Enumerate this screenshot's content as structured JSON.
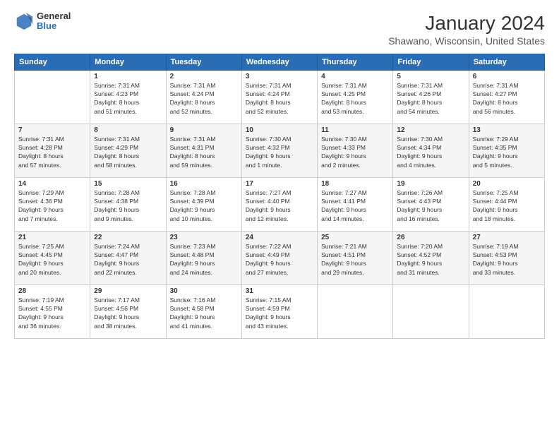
{
  "header": {
    "logo_general": "General",
    "logo_blue": "Blue",
    "title": "January 2024",
    "subtitle": "Shawano, Wisconsin, United States"
  },
  "days_of_week": [
    "Sunday",
    "Monday",
    "Tuesday",
    "Wednesday",
    "Thursday",
    "Friday",
    "Saturday"
  ],
  "weeks": [
    [
      {
        "day": "",
        "info": ""
      },
      {
        "day": "1",
        "info": "Sunrise: 7:31 AM\nSunset: 4:23 PM\nDaylight: 8 hours\nand 51 minutes."
      },
      {
        "day": "2",
        "info": "Sunrise: 7:31 AM\nSunset: 4:24 PM\nDaylight: 8 hours\nand 52 minutes."
      },
      {
        "day": "3",
        "info": "Sunrise: 7:31 AM\nSunset: 4:24 PM\nDaylight: 8 hours\nand 52 minutes."
      },
      {
        "day": "4",
        "info": "Sunrise: 7:31 AM\nSunset: 4:25 PM\nDaylight: 8 hours\nand 53 minutes."
      },
      {
        "day": "5",
        "info": "Sunrise: 7:31 AM\nSunset: 4:26 PM\nDaylight: 8 hours\nand 54 minutes."
      },
      {
        "day": "6",
        "info": "Sunrise: 7:31 AM\nSunset: 4:27 PM\nDaylight: 8 hours\nand 56 minutes."
      }
    ],
    [
      {
        "day": "7",
        "info": "Sunrise: 7:31 AM\nSunset: 4:28 PM\nDaylight: 8 hours\nand 57 minutes."
      },
      {
        "day": "8",
        "info": "Sunrise: 7:31 AM\nSunset: 4:29 PM\nDaylight: 8 hours\nand 58 minutes."
      },
      {
        "day": "9",
        "info": "Sunrise: 7:31 AM\nSunset: 4:31 PM\nDaylight: 8 hours\nand 59 minutes."
      },
      {
        "day": "10",
        "info": "Sunrise: 7:30 AM\nSunset: 4:32 PM\nDaylight: 9 hours\nand 1 minute."
      },
      {
        "day": "11",
        "info": "Sunrise: 7:30 AM\nSunset: 4:33 PM\nDaylight: 9 hours\nand 2 minutes."
      },
      {
        "day": "12",
        "info": "Sunrise: 7:30 AM\nSunset: 4:34 PM\nDaylight: 9 hours\nand 4 minutes."
      },
      {
        "day": "13",
        "info": "Sunrise: 7:29 AM\nSunset: 4:35 PM\nDaylight: 9 hours\nand 5 minutes."
      }
    ],
    [
      {
        "day": "14",
        "info": "Sunrise: 7:29 AM\nSunset: 4:36 PM\nDaylight: 9 hours\nand 7 minutes."
      },
      {
        "day": "15",
        "info": "Sunrise: 7:28 AM\nSunset: 4:38 PM\nDaylight: 9 hours\nand 9 minutes."
      },
      {
        "day": "16",
        "info": "Sunrise: 7:28 AM\nSunset: 4:39 PM\nDaylight: 9 hours\nand 10 minutes."
      },
      {
        "day": "17",
        "info": "Sunrise: 7:27 AM\nSunset: 4:40 PM\nDaylight: 9 hours\nand 12 minutes."
      },
      {
        "day": "18",
        "info": "Sunrise: 7:27 AM\nSunset: 4:41 PM\nDaylight: 9 hours\nand 14 minutes."
      },
      {
        "day": "19",
        "info": "Sunrise: 7:26 AM\nSunset: 4:43 PM\nDaylight: 9 hours\nand 16 minutes."
      },
      {
        "day": "20",
        "info": "Sunrise: 7:25 AM\nSunset: 4:44 PM\nDaylight: 9 hours\nand 18 minutes."
      }
    ],
    [
      {
        "day": "21",
        "info": "Sunrise: 7:25 AM\nSunset: 4:45 PM\nDaylight: 9 hours\nand 20 minutes."
      },
      {
        "day": "22",
        "info": "Sunrise: 7:24 AM\nSunset: 4:47 PM\nDaylight: 9 hours\nand 22 minutes."
      },
      {
        "day": "23",
        "info": "Sunrise: 7:23 AM\nSunset: 4:48 PM\nDaylight: 9 hours\nand 24 minutes."
      },
      {
        "day": "24",
        "info": "Sunrise: 7:22 AM\nSunset: 4:49 PM\nDaylight: 9 hours\nand 27 minutes."
      },
      {
        "day": "25",
        "info": "Sunrise: 7:21 AM\nSunset: 4:51 PM\nDaylight: 9 hours\nand 29 minutes."
      },
      {
        "day": "26",
        "info": "Sunrise: 7:20 AM\nSunset: 4:52 PM\nDaylight: 9 hours\nand 31 minutes."
      },
      {
        "day": "27",
        "info": "Sunrise: 7:19 AM\nSunset: 4:53 PM\nDaylight: 9 hours\nand 33 minutes."
      }
    ],
    [
      {
        "day": "28",
        "info": "Sunrise: 7:19 AM\nSunset: 4:55 PM\nDaylight: 9 hours\nand 36 minutes."
      },
      {
        "day": "29",
        "info": "Sunrise: 7:17 AM\nSunset: 4:56 PM\nDaylight: 9 hours\nand 38 minutes."
      },
      {
        "day": "30",
        "info": "Sunrise: 7:16 AM\nSunset: 4:58 PM\nDaylight: 9 hours\nand 41 minutes."
      },
      {
        "day": "31",
        "info": "Sunrise: 7:15 AM\nSunset: 4:59 PM\nDaylight: 9 hours\nand 43 minutes."
      },
      {
        "day": "",
        "info": ""
      },
      {
        "day": "",
        "info": ""
      },
      {
        "day": "",
        "info": ""
      }
    ]
  ]
}
